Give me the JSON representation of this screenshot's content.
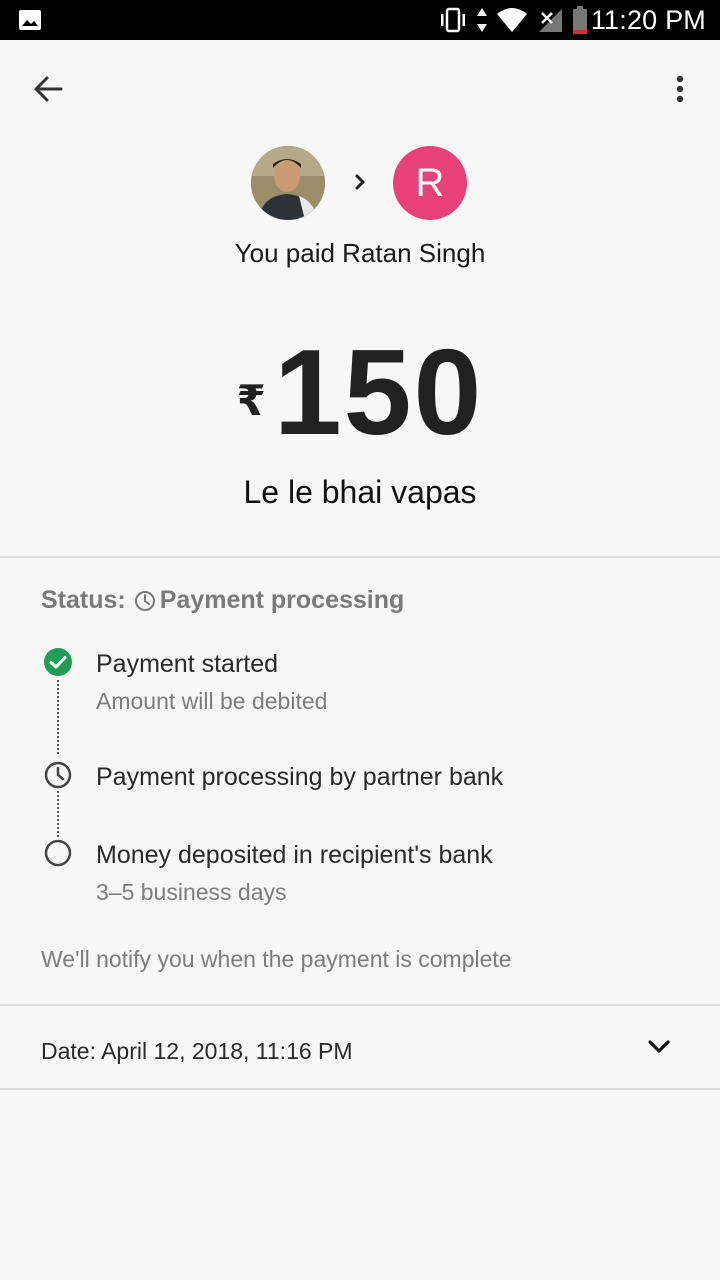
{
  "status_bar": {
    "time": "11:20 PM",
    "icons": [
      "gallery-icon",
      "vibrate-icon",
      "data-arrows-icon",
      "wifi-icon",
      "no-signal-icon",
      "battery-icon"
    ]
  },
  "app_bar": {
    "back_icon": "arrow-back-icon",
    "menu_icon": "more-vert-icon"
  },
  "header": {
    "recipient_initial": "R",
    "recipient_color": "#e8417a",
    "paid_text": "You paid Ratan Singh",
    "currency_symbol": "₹",
    "amount": "150",
    "note": "Le le bhai vapas"
  },
  "status": {
    "label": "Status:",
    "value": "Payment processing",
    "steps": [
      {
        "title": "Payment started",
        "subtitle": "Amount will be debited",
        "state": "done"
      },
      {
        "title": "Payment processing by partner bank",
        "subtitle": "",
        "state": "pending"
      },
      {
        "title": "Money deposited in recipient's bank",
        "subtitle": "3–5 business days",
        "state": "todo"
      }
    ],
    "notify_text": "We'll notify you when the payment is complete"
  },
  "details": {
    "date_text": "Date: April 12, 2018, 11:16 PM"
  },
  "colors": {
    "accent_green": "#1e9e55",
    "avatar_pink": "#e8417a"
  }
}
